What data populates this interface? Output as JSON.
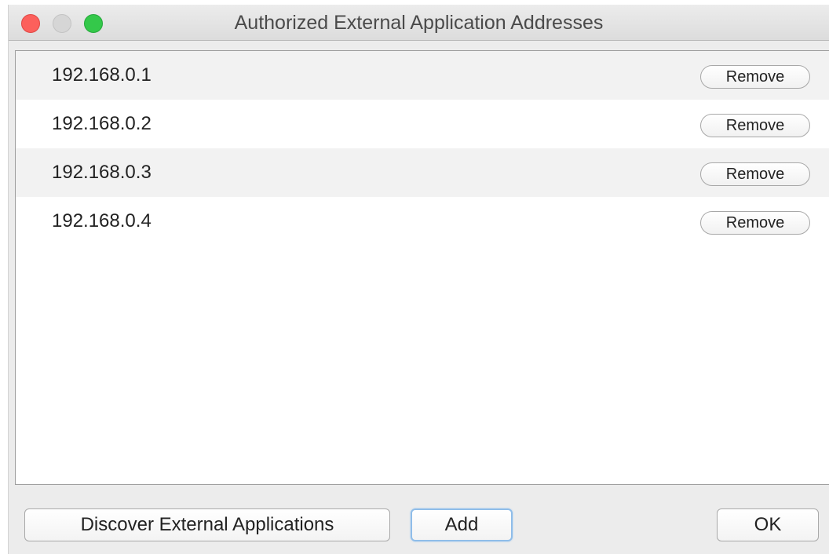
{
  "window": {
    "title": "Authorized External Application Addresses"
  },
  "addresses": [
    {
      "ip": "192.168.0.1",
      "remove_label": "Remove"
    },
    {
      "ip": "192.168.0.2",
      "remove_label": "Remove"
    },
    {
      "ip": "192.168.0.3",
      "remove_label": "Remove"
    },
    {
      "ip": "192.168.0.4",
      "remove_label": "Remove"
    }
  ],
  "footer": {
    "discover_label": "Discover External Applications",
    "add_label": "Add",
    "ok_label": "OK"
  },
  "colors": {
    "close": "#fc605c",
    "minimize_inactive": "#d6d6d6",
    "zoom": "#34c84a",
    "focus_ring": "#8fbde9"
  }
}
